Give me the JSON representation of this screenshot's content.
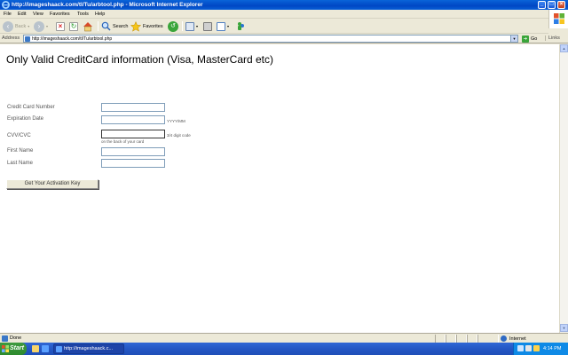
{
  "window": {
    "title": "http://imageshaack.com/tl/Tu/arbtool.php - Microsoft Internet Explorer"
  },
  "menu": [
    "File",
    "Edit",
    "View",
    "Favorites",
    "Tools",
    "Help"
  ],
  "toolbar": {
    "back_label": "Back",
    "search_label": "Search",
    "favorites_label": "Favorites"
  },
  "address": {
    "label": "Address",
    "url": "http://imageshaack.com/tl/Tu/arbtool.php",
    "go_label": "Go",
    "links_label": "Links"
  },
  "page": {
    "heading": "Only Valid CreditCard information (Visa, MasterCard etc)",
    "fields": {
      "card_number_label": "Credit Card Number",
      "expiration_label": "Expiration Date",
      "expiration_hint": "YYYY/MM",
      "cvv_label": "CVV/CVC",
      "cvv_hint": "3/4 digit code",
      "cvv_subhint": "on the back of your card",
      "first_name_label": "First Name",
      "last_name_label": "Last Name"
    },
    "submit_label": "Get Your Activation Key"
  },
  "status": {
    "text": "Done",
    "zone": "Internet"
  },
  "taskbar": {
    "start_label": "Start",
    "task_label": "http://imageshaack.c...",
    "clock": "4:14 PM"
  }
}
